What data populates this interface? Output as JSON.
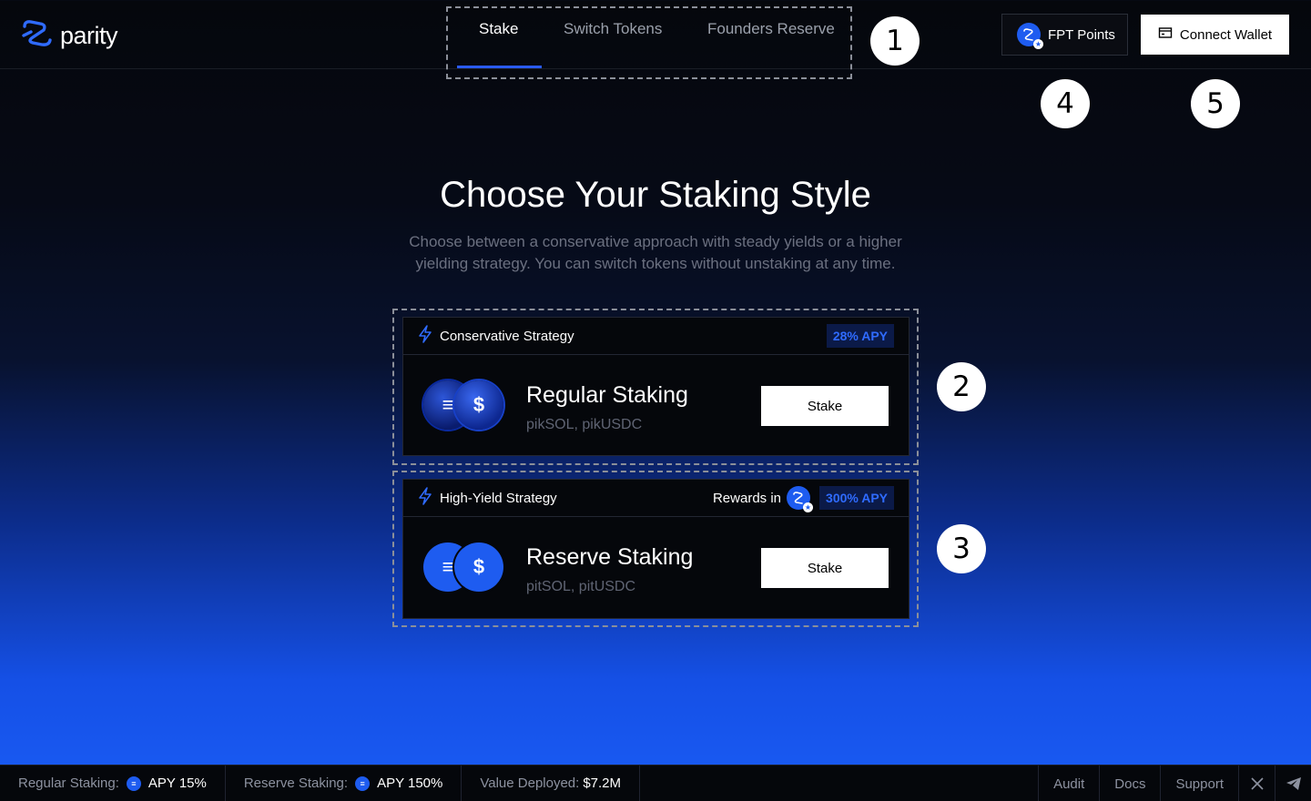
{
  "brand": {
    "name": "parity"
  },
  "nav": {
    "tabs": [
      {
        "label": "Stake",
        "active": true
      },
      {
        "label": "Switch Tokens",
        "active": false
      },
      {
        "label": "Founders Reserve",
        "active": false
      }
    ]
  },
  "header": {
    "points_label": "FPT Points",
    "wallet_label": "Connect Wallet"
  },
  "callouts": [
    "1",
    "2",
    "3",
    "4",
    "5"
  ],
  "hero": {
    "title": "Choose Your Staking Style",
    "subtitle": "Choose between a conservative approach with steady yields or a higher yielding strategy. You can switch tokens without unstaking at any time."
  },
  "cards": [
    {
      "strategy": "Conservative Strategy",
      "apy": "28% APY",
      "title": "Regular Staking",
      "tokens": "pikSOL, pikUSDC",
      "button": "Stake"
    },
    {
      "strategy": "High-Yield Strategy",
      "rewards_label": "Rewards in",
      "apy": "300% APY",
      "title": "Reserve Staking",
      "tokens": "pitSOL, pitUSDC",
      "button": "Stake"
    }
  ],
  "footer": {
    "regular_label": "Regular Staking:",
    "regular_value": "APY 15%",
    "reserve_label": "Reserve Staking:",
    "reserve_value": "APY 150%",
    "deployed_label": "Value Deployed:",
    "deployed_value": "$7.2M",
    "links": [
      "Audit",
      "Docs",
      "Support"
    ]
  },
  "colors": {
    "accent": "#2a5bf0",
    "coin_blue": "#1e5cf0",
    "apy_text": "#2f6bff"
  },
  "icons": {
    "logo": "parity-logo-icon",
    "points": "fpt-token-icon",
    "wallet": "wallet-icon",
    "bolt": "bolt-icon",
    "sol": "sol-coin-icon",
    "usdc": "usdc-coin-icon",
    "x": "x-logo-icon",
    "telegram": "telegram-icon"
  }
}
